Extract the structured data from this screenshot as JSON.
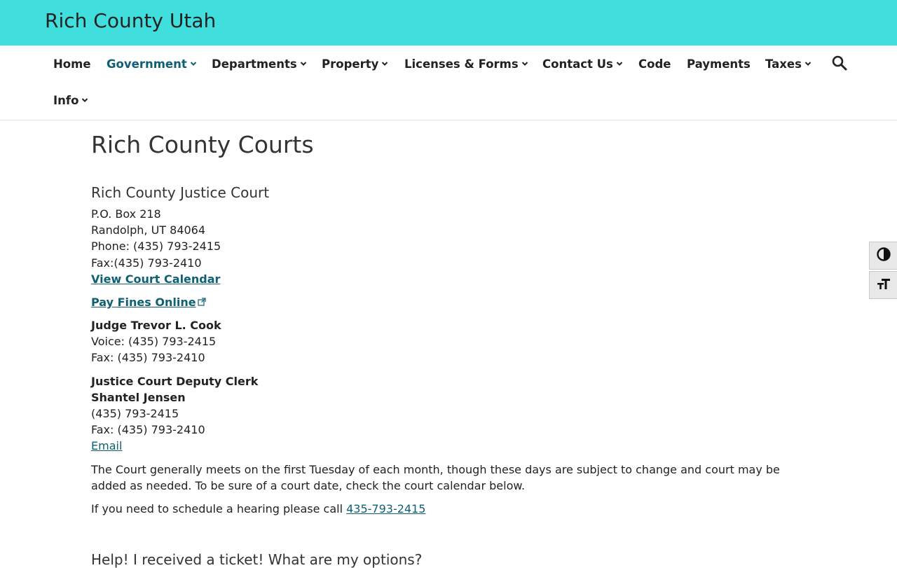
{
  "header": {
    "site_title": "Rich County Utah",
    "bg_color": "#40dedd"
  },
  "nav": {
    "items": [
      {
        "label": "Home",
        "dropdown": false
      },
      {
        "label": "Government",
        "dropdown": true,
        "active": true
      },
      {
        "label": "Departments",
        "dropdown": true
      },
      {
        "label": "Property",
        "dropdown": true
      },
      {
        "label": "Licenses & Forms",
        "dropdown": true
      },
      {
        "label": "Contact Us",
        "dropdown": true
      },
      {
        "label": "Code",
        "dropdown": false
      },
      {
        "label": "Payments",
        "dropdown": false
      },
      {
        "label": "Taxes",
        "dropdown": true
      },
      {
        "label": "Info",
        "dropdown": true
      }
    ],
    "active_color": "#0f6073",
    "search_icon": "search-icon"
  },
  "accessibility": {
    "contrast_icon": "contrast-toggle-icon",
    "font_size_icon": "font-size-toggle-icon"
  },
  "page": {
    "title": "Rich County Courts",
    "section_title": "Rich County Justice Court",
    "address_line1": "P.O. Box 218",
    "address_line2": "Randolph, UT 84064",
    "phone": "Phone: (435) 793-2415",
    "fax": "Fax:(435) 793-2410",
    "calendar_link": "View Court Calendar",
    "pay_fines_link": "Pay Fines Online",
    "judge_name": "Judge Trevor L. Cook",
    "judge_voice": "Voice: (435) 793-2415",
    "judge_fax": "Fax: (435) 793-2410",
    "clerk_title": "Justice Court Deputy Clerk",
    "clerk_name": "Shantel Jensen",
    "clerk_phone": "(435) 793-2415",
    "clerk_fax": "Fax: (435) 793-2410",
    "email_link": "Email",
    "schedule_paragraph": "The Court generally meets on the first Tuesday of each month, though these days are subject to change and court may be added as needed. To be sure of a court date, check the court calendar below.",
    "hearing_prefix": "If you need to schedule a hearing please call ",
    "hearing_phone_link": "435-793-2415",
    "next_heading": "Help! I received a ticket! What are my options?",
    "link_color": "#0f6073"
  }
}
